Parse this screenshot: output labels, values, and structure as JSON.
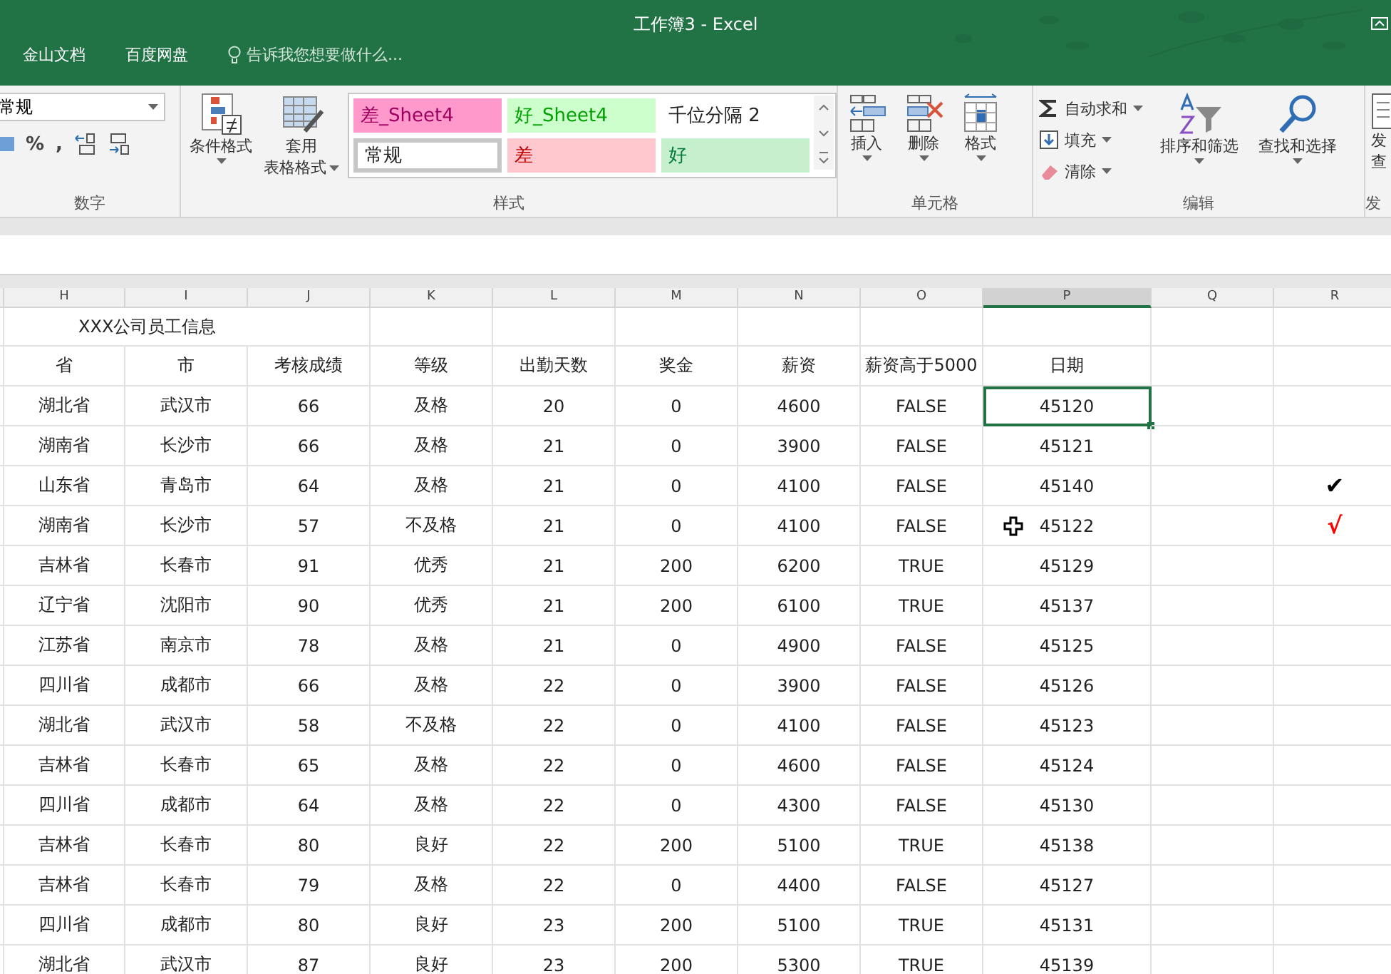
{
  "window": {
    "title": "工作簿3 - Excel"
  },
  "menu": {
    "items": [
      "金山文档",
      "百度网盘"
    ],
    "tell_me": {
      "placeholder": "告诉我您想要做什么..."
    }
  },
  "ribbon": {
    "number": {
      "format": "常规",
      "percent": "%",
      "comma": ",",
      "label": "数字"
    },
    "styles": {
      "conditional": "条件格式",
      "table_format": [
        "套用",
        "表格格式"
      ],
      "label": "样式",
      "gallery": [
        {
          "label": "差_Sheet4",
          "kind": "bad_sheet",
          "selected": false
        },
        {
          "label": "好_Sheet4",
          "kind": "good_sheet",
          "selected": false
        },
        {
          "label": "千位分隔 2",
          "kind": "plain",
          "selected": false
        },
        {
          "label": "常规",
          "kind": "plain",
          "selected": true
        },
        {
          "label": "差",
          "kind": "bad",
          "selected": false
        },
        {
          "label": "好",
          "kind": "good",
          "selected": false
        }
      ]
    },
    "cells": {
      "buttons": [
        {
          "label": "插入",
          "kind": "insert"
        },
        {
          "label": "删除",
          "kind": "delete"
        },
        {
          "label": "格式",
          "kind": "format"
        }
      ],
      "label": "单元格"
    },
    "editing": {
      "small": [
        {
          "label": "自动求和",
          "kind": "sum"
        },
        {
          "label": "填充",
          "kind": "fill"
        },
        {
          "label": "清除",
          "kind": "clear"
        }
      ],
      "big": [
        {
          "label": "排序和筛选",
          "kind": "sort"
        },
        {
          "label": "查找和选择",
          "kind": "find"
        }
      ],
      "label": "编辑"
    },
    "partial": {
      "button": [
        "发",
        "查"
      ],
      "label": "发"
    }
  },
  "sheet": {
    "columns": [
      {
        "label": "H",
        "selected": false
      },
      {
        "label": "I",
        "selected": false
      },
      {
        "label": "J",
        "selected": false
      },
      {
        "label": "K",
        "selected": false
      },
      {
        "label": "L",
        "selected": false
      },
      {
        "label": "M",
        "selected": false
      },
      {
        "label": "N",
        "selected": false
      },
      {
        "label": "O",
        "selected": false
      },
      {
        "label": "P",
        "selected": true
      },
      {
        "label": "Q",
        "selected": false
      },
      {
        "label": "R",
        "selected": false
      }
    ],
    "title": "XXX公司员工信息",
    "headers": [
      "省",
      "市",
      "考核成绩",
      "等级",
      "出勤天数",
      "奖金",
      "薪资",
      "薪资高于5000",
      "日期"
    ],
    "rows": [
      {
        "cells": [
          "湖北省",
          "武汉市",
          "66",
          "及格",
          "20",
          "0",
          "4600",
          "FALSE",
          "45120"
        ],
        "selected": true,
        "pointer": false
      },
      {
        "cells": [
          "湖南省",
          "长沙市",
          "66",
          "及格",
          "21",
          "0",
          "3900",
          "FALSE",
          "45121"
        ],
        "selected": false,
        "pointer": false
      },
      {
        "cells": [
          "山东省",
          "青岛市",
          "64",
          "及格",
          "21",
          "0",
          "4100",
          "FALSE",
          "45140"
        ],
        "selected": false,
        "pointer": false,
        "mark": "✔",
        "color": "#000000"
      },
      {
        "cells": [
          "湖南省",
          "长沙市",
          "57",
          "不及格",
          "21",
          "0",
          "4100",
          "FALSE",
          "45122"
        ],
        "selected": false,
        "pointer": true,
        "mark": "√",
        "color": "#ff0000"
      },
      {
        "cells": [
          "吉林省",
          "长春市",
          "91",
          "优秀",
          "21",
          "200",
          "6200",
          "TRUE",
          "45129"
        ],
        "selected": false,
        "pointer": false
      },
      {
        "cells": [
          "辽宁省",
          "沈阳市",
          "90",
          "优秀",
          "21",
          "200",
          "6100",
          "TRUE",
          "45137"
        ],
        "selected": false,
        "pointer": false
      },
      {
        "cells": [
          "江苏省",
          "南京市",
          "78",
          "及格",
          "21",
          "0",
          "4900",
          "FALSE",
          "45125"
        ],
        "selected": false,
        "pointer": false
      },
      {
        "cells": [
          "四川省",
          "成都市",
          "66",
          "及格",
          "22",
          "0",
          "3900",
          "FALSE",
          "45126"
        ],
        "selected": false,
        "pointer": false
      },
      {
        "cells": [
          "湖北省",
          "武汉市",
          "58",
          "不及格",
          "22",
          "0",
          "4100",
          "FALSE",
          "45123"
        ],
        "selected": false,
        "pointer": false
      },
      {
        "cells": [
          "吉林省",
          "长春市",
          "65",
          "及格",
          "22",
          "0",
          "4600",
          "FALSE",
          "45124"
        ],
        "selected": false,
        "pointer": false
      },
      {
        "cells": [
          "四川省",
          "成都市",
          "64",
          "及格",
          "22",
          "0",
          "4300",
          "FALSE",
          "45130"
        ],
        "selected": false,
        "pointer": false
      },
      {
        "cells": [
          "吉林省",
          "长春市",
          "80",
          "良好",
          "22",
          "200",
          "5100",
          "TRUE",
          "45138"
        ],
        "selected": false,
        "pointer": false
      },
      {
        "cells": [
          "吉林省",
          "长春市",
          "79",
          "及格",
          "22",
          "0",
          "4400",
          "FALSE",
          "45127"
        ],
        "selected": false,
        "pointer": false
      },
      {
        "cells": [
          "四川省",
          "成都市",
          "80",
          "良好",
          "23",
          "200",
          "5100",
          "TRUE",
          "45131"
        ],
        "selected": false,
        "pointer": false
      },
      {
        "cells": [
          "湖北省",
          "武汉市",
          "87",
          "良好",
          "23",
          "200",
          "5300",
          "TRUE",
          "45139"
        ],
        "selected": false,
        "pointer": false
      }
    ]
  }
}
